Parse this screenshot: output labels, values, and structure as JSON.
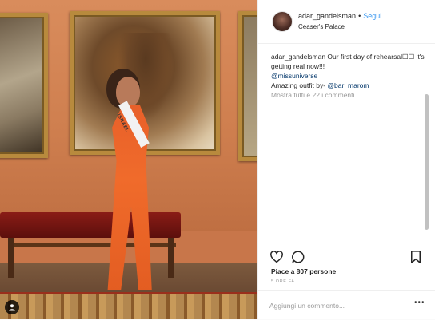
{
  "post": {
    "username": "adar_gandelsman",
    "separator": "•",
    "follow_label": "Segui",
    "location": "Ceaser's Palace",
    "caption": {
      "username": "adar_gandelsman",
      "text": " Our first day of rehearsal☐☐ it's getting real now!!!",
      "mention": "@missuniverse",
      "outfit_text": "Amazing outfit by- ",
      "outfit_mention": "@bar_marom"
    },
    "view_comments": "Mostra tutti e 22 i commenti",
    "likes": "Piace a 807 persone",
    "time": "5 ORE FA",
    "comment_placeholder": "Aggiungi un commento...",
    "more_label": "•••",
    "photo": {
      "sash_text": "ISRAEL"
    }
  },
  "icons": {
    "like": "heart-icon",
    "comment": "comment-bubble-icon",
    "save": "bookmark-icon",
    "tagged": "user-tag-icon"
  },
  "colors": {
    "follow": "#3897f0",
    "mention": "#003569",
    "text": "#262626",
    "muted": "#999999",
    "dress": "#f06b2b"
  }
}
